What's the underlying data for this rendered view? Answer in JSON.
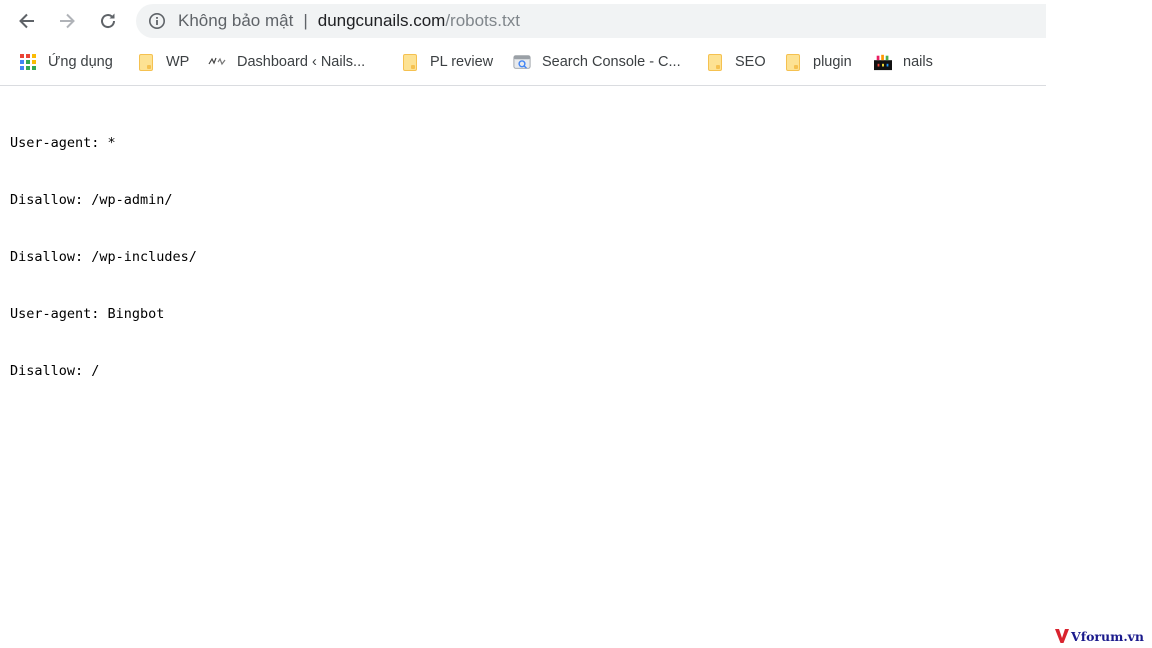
{
  "toolbar": {
    "security_label": "Không bảo mật",
    "separator": "|",
    "url_host": "dungcunails.com",
    "url_path": "/robots.txt"
  },
  "bookmarks": [
    {
      "label": "Ứng dụng",
      "icon": "apps-grid-icon"
    },
    {
      "label": "WP",
      "icon": "folder-icon"
    },
    {
      "label": "Dashboard ‹ Nails...",
      "icon": "site-favicon"
    },
    {
      "label": "PL review",
      "icon": "folder-icon"
    },
    {
      "label": "Search Console - C...",
      "icon": "search-console-icon"
    },
    {
      "label": "SEO",
      "icon": "folder-icon"
    },
    {
      "label": "plugin",
      "icon": "folder-icon"
    },
    {
      "label": "nails",
      "icon": "nails-favicon"
    }
  ],
  "document": {
    "lines": [
      "User-agent: *",
      "Disallow: /wp-admin/",
      "Disallow: /wp-includes/",
      "User-agent: Bingbot",
      "Disallow: /"
    ]
  },
  "watermark": {
    "text": "Vforum.vn"
  },
  "colors": {
    "omnibox_bg": "#f1f3f4",
    "folder_fill": "#fde293",
    "watermark_red": "#d9232e",
    "watermark_text": "#1a1a8c"
  }
}
